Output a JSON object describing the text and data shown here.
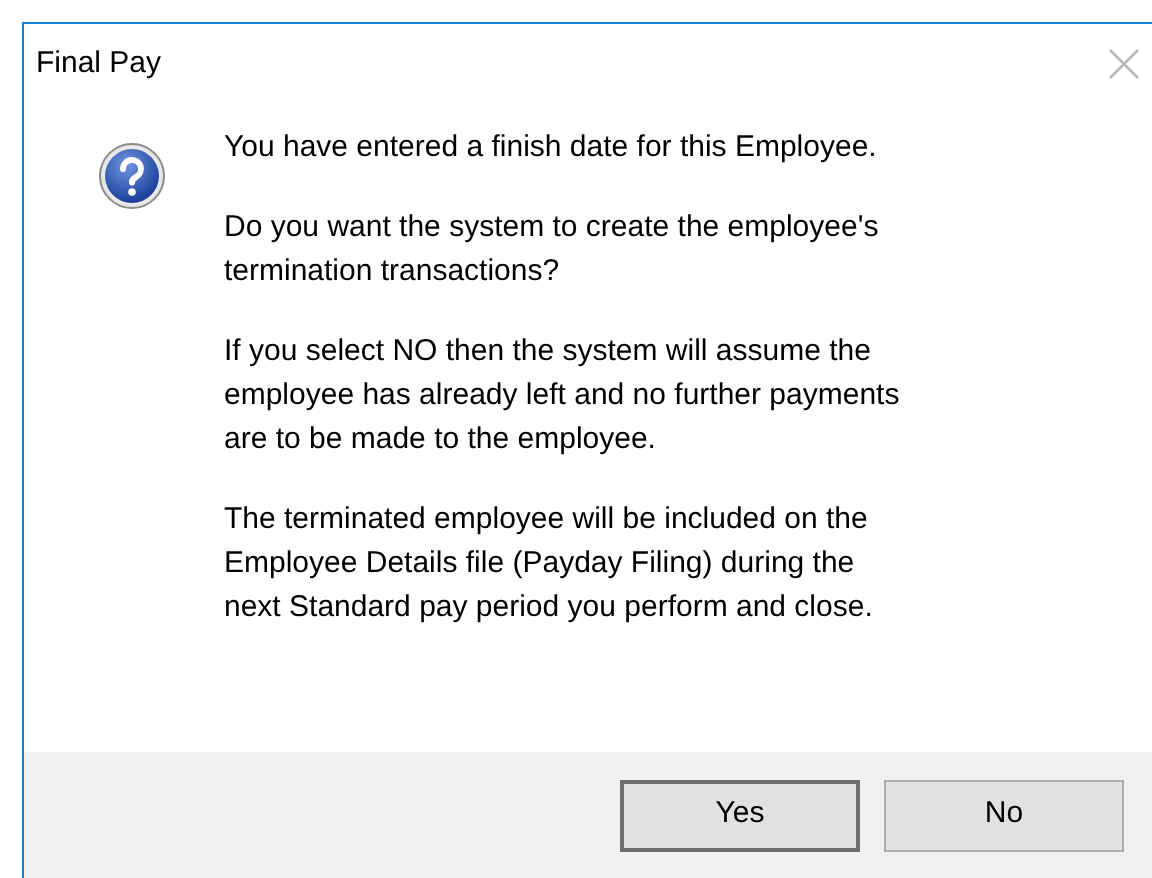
{
  "window": {
    "title": "Final Pay"
  },
  "message": [
    "You have entered a finish date for this Employee.",
    "Do you want the system to create the employee's termination transactions?",
    "If you select NO then the system will assume the employee has already left and no further payments are to be made to the employee.",
    "The terminated employee will be included on the Employee Details file (Payday Filing) during the next Standard pay period you perform and close."
  ],
  "buttons": [
    {
      "label": "Yes",
      "default": true
    },
    {
      "label": "No",
      "default": false
    }
  ]
}
